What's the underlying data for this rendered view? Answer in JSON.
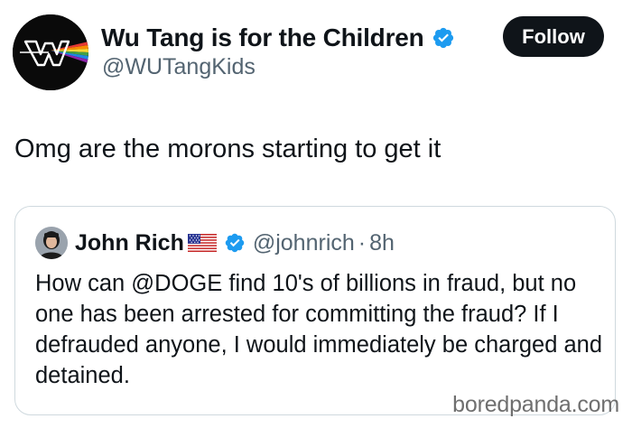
{
  "author": {
    "display_name": "Wu Tang is for the Children",
    "handle": "@WUTangKids",
    "verified_icon": "verified-badge-icon",
    "avatar_icon": "wu-tang-logo-avatar"
  },
  "follow_button": {
    "label": "Follow"
  },
  "tweet": {
    "text": "Omg are the morons starting to get it"
  },
  "quote": {
    "display_name": "John Rich",
    "flag_icon": "us-flag-icon",
    "verified_icon": "verified-badge-icon",
    "handle": "@johnrich",
    "separator": "·",
    "time": "8h",
    "text": "How can @DOGE find 10's of billions in fraud, but no one has been arrested for committing the fraud? If I defrauded anyone, I would immediately be charged and detained."
  },
  "watermark": {
    "text": "boredpanda.com"
  },
  "colors": {
    "text_primary": "#0f1419",
    "text_secondary": "#536471",
    "verified_blue": "#1d9bf0",
    "button_bg": "#0f1419",
    "card_border": "#cfd9de"
  }
}
